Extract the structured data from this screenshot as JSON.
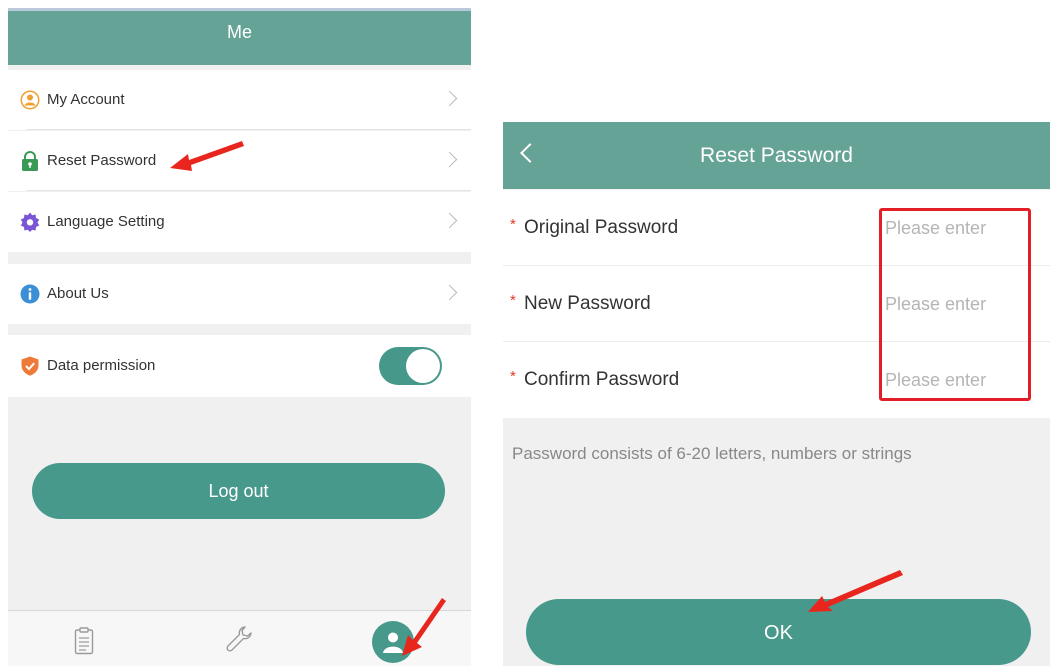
{
  "me_screen": {
    "title": "Me",
    "menu_items": [
      {
        "label": "My Account",
        "icon": "user-circle-icon"
      },
      {
        "label": "Reset Password",
        "icon": "lock-icon"
      },
      {
        "label": "Language Setting",
        "icon": "gear-icon"
      },
      {
        "label": "About Us",
        "icon": "info-icon"
      }
    ],
    "data_permission": {
      "label": "Data permission",
      "icon": "shield-icon",
      "enabled": true
    },
    "logout_label": "Log out",
    "tabs": [
      {
        "icon": "clipboard-icon"
      },
      {
        "icon": "wrench-icon"
      },
      {
        "icon": "person-icon",
        "active": true
      }
    ]
  },
  "reset_screen": {
    "title": "Reset Password",
    "fields": [
      {
        "required_mark": "*",
        "label": "Original Password",
        "placeholder": "Please enter"
      },
      {
        "required_mark": "*",
        "label": "New Password",
        "placeholder": "Please enter"
      },
      {
        "required_mark": "*",
        "label": "Confirm Password",
        "placeholder": "Please enter"
      }
    ],
    "hint": "Password consists of 6-20 letters, numbers or strings",
    "ok_label": "OK"
  },
  "colors": {
    "header": "#66a397",
    "accent": "#47998b",
    "highlight": "#e21f26"
  }
}
